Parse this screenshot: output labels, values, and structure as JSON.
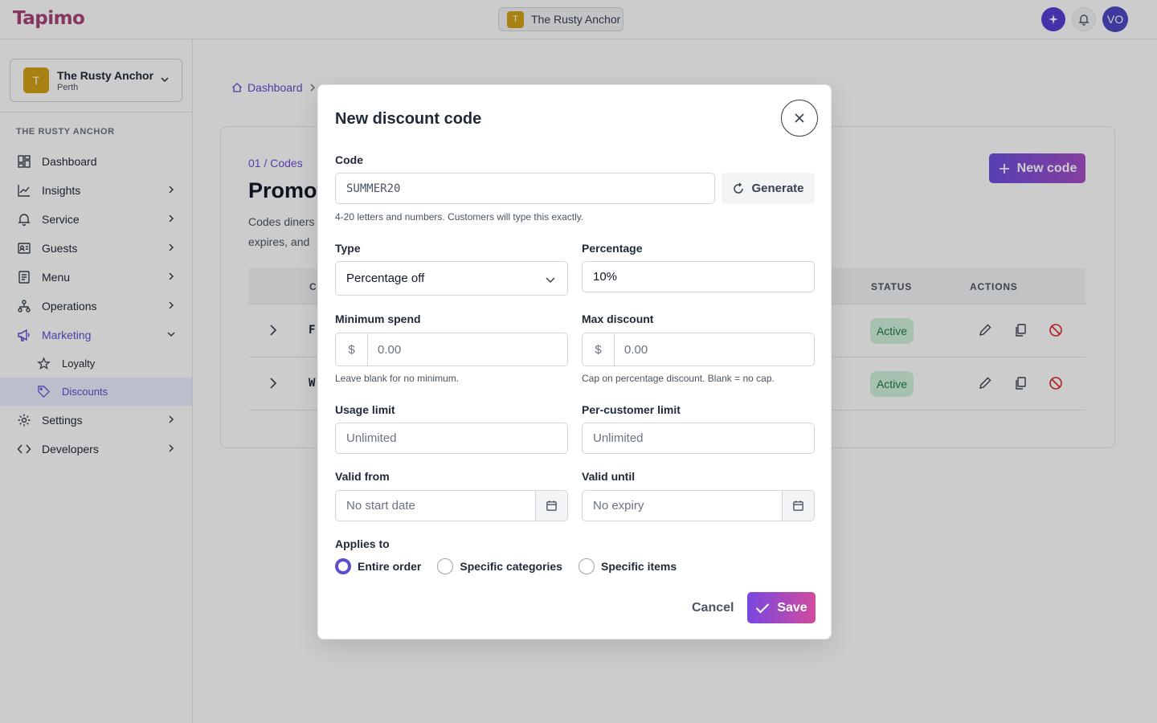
{
  "app": {
    "logo": "Tapimo"
  },
  "topbar": {
    "venue_initial": "T",
    "venue_name": "The Rusty Anchor",
    "avatar_initials": "VO"
  },
  "sidebar": {
    "venue": {
      "initial": "T",
      "name": "The Rusty Anchor",
      "city": "Perth"
    },
    "section_title": "THE RUSTY ANCHOR",
    "items": [
      {
        "label": "Dashboard",
        "icon": "dashboard-icon"
      },
      {
        "label": "Insights",
        "icon": "chart-icon"
      },
      {
        "label": "Service",
        "icon": "bell-icon"
      },
      {
        "label": "Guests",
        "icon": "id-card-icon"
      },
      {
        "label": "Menu",
        "icon": "menu-book-icon"
      },
      {
        "label": "Operations",
        "icon": "org-icon"
      },
      {
        "label": "Marketing",
        "icon": "megaphone-icon"
      },
      {
        "label": "Settings",
        "icon": "gear-icon"
      },
      {
        "label": "Developers",
        "icon": "code-icon"
      }
    ],
    "marketing_children": [
      {
        "label": "Loyalty",
        "icon": "star-icon"
      },
      {
        "label": "Discounts",
        "icon": "tag-icon"
      }
    ]
  },
  "main": {
    "breadcrumb": "Dashboard",
    "eyebrow": "01 / Codes",
    "title": "Promot",
    "description_lines": [
      "Codes diners",
      "expires, and"
    ],
    "new_code_label": "New code",
    "table": {
      "headers": [
        "CO",
        "STATUS",
        "ACTIONS"
      ],
      "rows": [
        {
          "code_start": "F",
          "status": "Active"
        },
        {
          "code_start": "W",
          "status": "Active"
        }
      ]
    }
  },
  "modal": {
    "title": "New discount code",
    "code_label": "Code",
    "code_value": "SUMMER20",
    "generate_label": "Generate",
    "code_hint": "4-20 letters and numbers. Customers will type this exactly.",
    "type_label": "Type",
    "type_value": "Percentage off",
    "percentage_label": "Percentage",
    "percentage_value": "10%",
    "min_spend_label": "Minimum spend",
    "currency_symbol": "$",
    "min_spend_placeholder": "0.00",
    "min_spend_hint": "Leave blank for no minimum.",
    "max_discount_label": "Max discount",
    "max_discount_placeholder": "0.00",
    "max_discount_hint": "Cap on percentage discount. Blank = no cap.",
    "usage_limit_label": "Usage limit",
    "usage_limit_placeholder": "Unlimited",
    "per_customer_label": "Per-customer limit",
    "per_customer_placeholder": "Unlimited",
    "valid_from_label": "Valid from",
    "valid_from_placeholder": "No start date",
    "valid_until_label": "Valid until",
    "valid_until_placeholder": "No expiry",
    "applies_to_label": "Applies to",
    "applies_options": [
      "Entire order",
      "Specific categories",
      "Specific items"
    ],
    "applies_selected": "Entire order",
    "cancel_label": "Cancel",
    "save_label": "Save"
  },
  "colors": {
    "accent": "#5b4fd0",
    "brand": "#a64478",
    "venue": "#d4a017",
    "status_active_bg": "#d1f2dc",
    "danger": "#dc2626"
  }
}
